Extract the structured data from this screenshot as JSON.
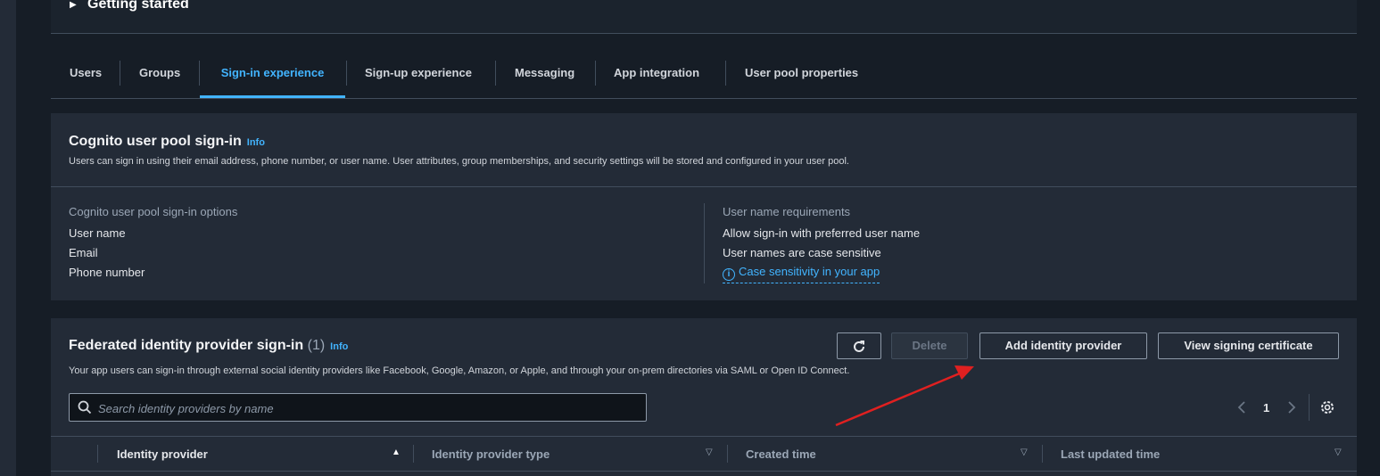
{
  "getting_started": {
    "label": "Getting started"
  },
  "tabs": [
    {
      "label": "Users"
    },
    {
      "label": "Groups"
    },
    {
      "label": "Sign-in experience"
    },
    {
      "label": "Sign-up experience"
    },
    {
      "label": "Messaging"
    },
    {
      "label": "App integration"
    },
    {
      "label": "User pool properties"
    }
  ],
  "cognito_signin": {
    "title": "Cognito user pool sign-in",
    "info": "Info",
    "description": "Users can sign in using their email address, phone number, or user name. User attributes, group memberships, and security settings will be stored and configured in your user pool.",
    "options_label": "Cognito user pool sign-in options",
    "options": [
      "User name",
      "Email",
      "Phone number"
    ],
    "requirements_label": "User name requirements",
    "requirements": [
      "Allow sign-in with preferred user name",
      "User names are case sensitive"
    ],
    "case_link": "Case sensitivity in your app"
  },
  "federated": {
    "title": "Federated identity provider sign-in",
    "count": "(1)",
    "info": "Info",
    "description": "Your app users can sign-in through external social identity providers like Facebook, Google, Amazon, or Apple, and through your on-prem directories via SAML or Open ID Connect.",
    "delete_label": "Delete",
    "add_label": "Add identity provider",
    "view_cert_label": "View signing certificate",
    "search_placeholder": "Search identity providers by name",
    "page": "1",
    "columns": [
      "Identity provider",
      "Identity provider type",
      "Created time",
      "Last updated time"
    ]
  },
  "colors": {
    "accent": "#42b4ff",
    "annotation_arrow": "#e02020"
  }
}
